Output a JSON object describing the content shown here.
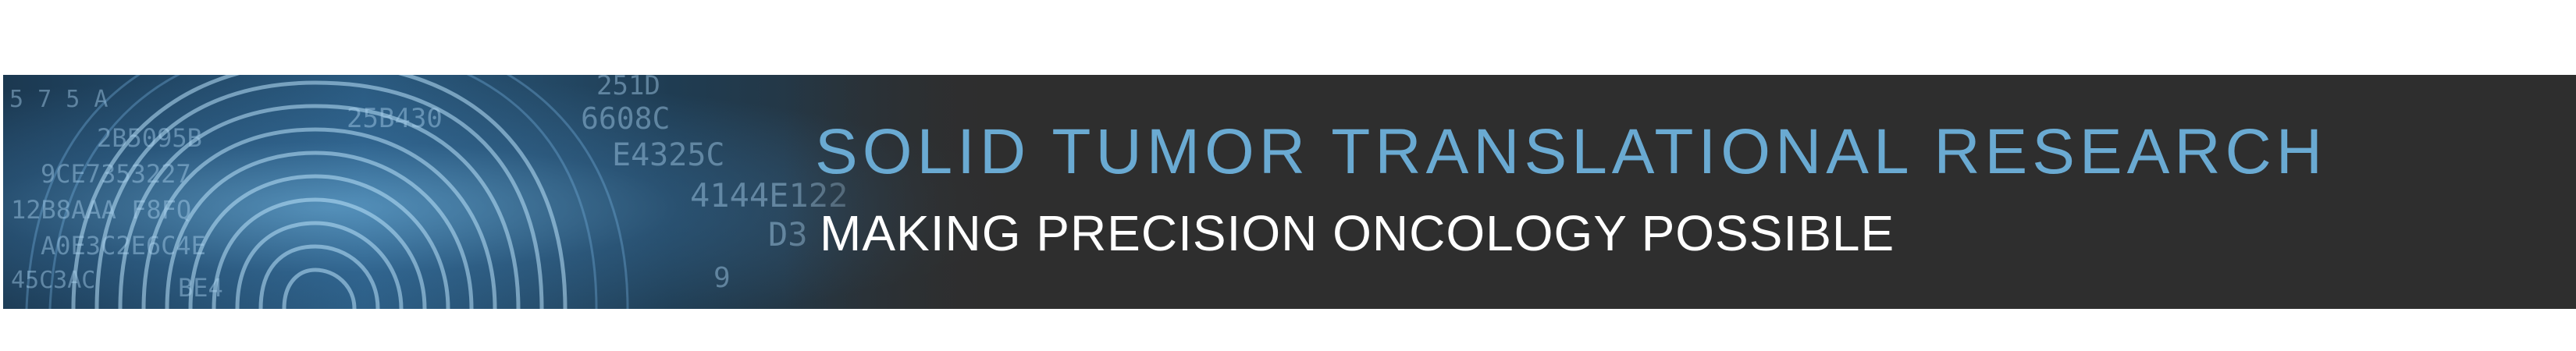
{
  "banner": {
    "title": "SOLID TUMOR TRANSLATIONAL RESEARCH",
    "subtitle": "MAKING PRECISION ONCOLOGY POSSIBLE",
    "title_color": "#6aaad2",
    "subtitle_color": "#ffffff",
    "background_color": "#2e2e2e"
  },
  "hero_image": {
    "icon": "fingerprint-icon",
    "hex_fragments": [
      "5 7 5 A",
      "2B5095B",
      "9CE7353227",
      "12B8AAA F8FQ",
      "A0E3C2E6C4E",
      "45C3AC",
      "BE4",
      "25B430",
      "251D",
      "6608C",
      "E4325C",
      "4144E122",
      "D3",
      "9"
    ]
  }
}
